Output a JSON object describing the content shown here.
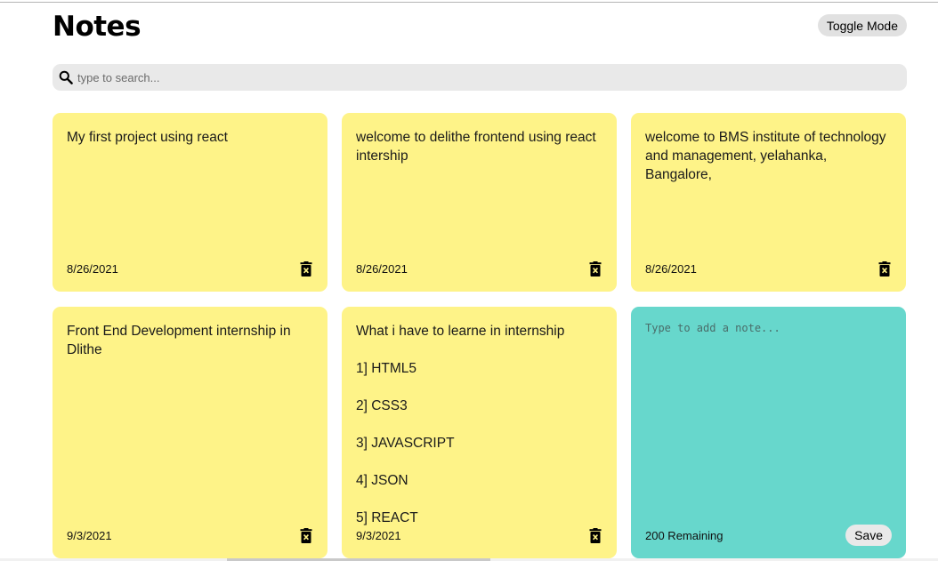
{
  "header": {
    "title": "Notes",
    "toggle_label": "Toggle Mode"
  },
  "search": {
    "placeholder": "type to search...",
    "icon": "search-icon"
  },
  "notes": [
    {
      "text": "My first project using react",
      "date": "8/26/2021"
    },
    {
      "text": "welcome to delithe frontend using react intership",
      "date": "8/26/2021"
    },
    {
      "text": "welcome to BMS institute of technology and management, yelahanka, Bangalore,",
      "date": "8/26/2021"
    },
    {
      "text": "Front End Development internship in Dlithe",
      "date": "9/3/2021"
    },
    {
      "text": "What i have to learne in internship\n\n1] HTML5\n\n2] CSS3\n\n3] JAVASCRIPT\n\n4] JSON\n\n5] REACT",
      "date": "9/3/2021"
    }
  ],
  "new_note": {
    "placeholder": "Type to add a note...",
    "remaining": "200 Remaining",
    "save_label": "Save"
  },
  "colors": {
    "note_bg": "#fef388",
    "new_note_bg": "#67d7cc",
    "search_bg": "#e9e9e9"
  }
}
